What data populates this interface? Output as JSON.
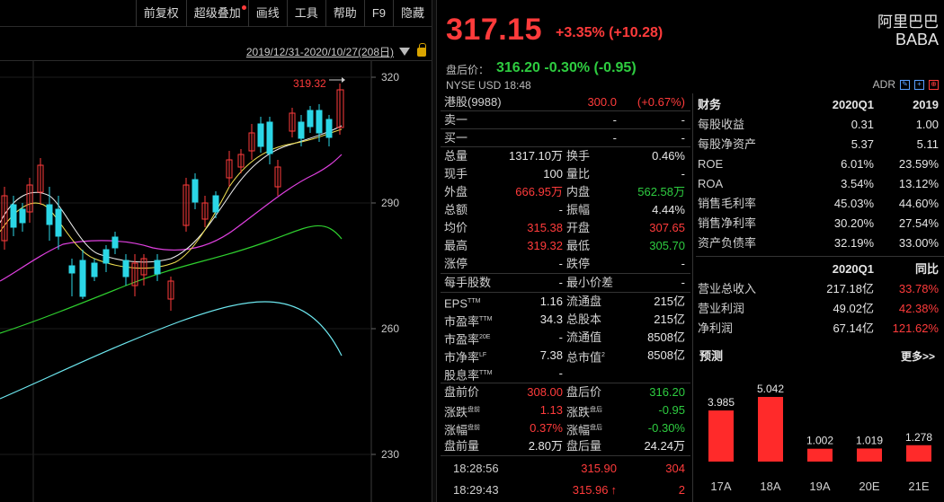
{
  "toolbar": {
    "items": [
      "前复权",
      "超级叠加",
      "画线",
      "工具",
      "帮助",
      "F9",
      "隐藏"
    ]
  },
  "chart": {
    "range": "2019/12/31-2020/10/27(208日)",
    "high_label": "319.32",
    "y_ticks": [
      "320",
      "290",
      "260",
      "230"
    ]
  },
  "header": {
    "price": "317.15",
    "change": "+3.35% (+10.28)",
    "name": "阿里巴巴",
    "code": "BABA",
    "after_hours_label": "盘后价：",
    "after_hours_value": "316.20 -0.30% (-0.95)",
    "exchange_line": "NYSE   USD   18:48",
    "adr_label": "ADR"
  },
  "hk": {
    "label": "港股(9988)",
    "price": "300.0",
    "change": "(+0.67%)"
  },
  "order_book": [
    {
      "label": "卖一",
      "price": "-",
      "vol": "-"
    },
    {
      "label": "买一",
      "price": "-",
      "vol": "-"
    }
  ],
  "stats": [
    {
      "l1": "总量",
      "v1": "1317.10万",
      "c1": "white",
      "l2": "换手",
      "v2": "0.46%",
      "c2": "white"
    },
    {
      "l1": "现手",
      "v1": "100",
      "c1": "white",
      "l2": "量比",
      "v2": "-",
      "c2": "white"
    },
    {
      "l1": "外盘",
      "v1": "666.95万",
      "c1": "red",
      "l2": "内盘",
      "v2": "562.58万",
      "c2": "green"
    },
    {
      "l1": "总额",
      "v1": "-",
      "c1": "white",
      "l2": "振幅",
      "v2": "4.44%",
      "c2": "white"
    },
    {
      "l1": "均价",
      "v1": "315.38",
      "c1": "red",
      "l2": "开盘",
      "v2": "307.65",
      "c2": "red"
    },
    {
      "l1": "最高",
      "v1": "319.32",
      "c1": "red",
      "l2": "最低",
      "v2": "305.70",
      "c2": "green"
    },
    {
      "l1": "涨停",
      "v1": "-",
      "c1": "white",
      "l2": "跌停",
      "v2": "-",
      "c2": "white"
    }
  ],
  "stats2": [
    {
      "l1": "每手股数",
      "v1": "-",
      "c1": "white",
      "l2": "最小价差",
      "v2": "-",
      "c2": "white"
    }
  ],
  "stats3": [
    {
      "l1": "EPS",
      "s1": "TTM",
      "v1": "1.16",
      "c1": "white",
      "l2": "流通盘",
      "s2": "",
      "v2": "215亿",
      "c2": "white"
    },
    {
      "l1": "市盈率",
      "s1": "TTM",
      "v1": "34.3",
      "c1": "white",
      "l2": "总股本",
      "s2": "",
      "v2": "215亿",
      "c2": "white"
    },
    {
      "l1": "市盈率",
      "s1": "20E",
      "v1": "-",
      "c1": "white",
      "l2": "流通值",
      "s2": "",
      "v2": "8508亿",
      "c2": "white"
    },
    {
      "l1": "市净率",
      "s1": "LF",
      "v1": "7.38",
      "c1": "white",
      "l2": "总市值",
      "s2": "2",
      "v2": "8508亿",
      "c2": "white"
    },
    {
      "l1": "股息率",
      "s1": "TTM",
      "v1": "-",
      "c1": "white",
      "l2": "",
      "s2": "",
      "v2": "",
      "c2": "white"
    }
  ],
  "stats4": [
    {
      "l1": "盘前价",
      "s1": "",
      "v1": "308.00",
      "c1": "red",
      "l2": "盘后价",
      "s2": "",
      "v2": "316.20",
      "c2": "green"
    },
    {
      "l1": "涨跌",
      "s1": "盘前",
      "v1": "1.13",
      "c1": "red",
      "l2": "涨跌",
      "s2": "盘后",
      "v2": "-0.95",
      "c2": "green"
    },
    {
      "l1": "涨幅",
      "s1": "盘前",
      "v1": "0.37%",
      "c1": "red",
      "l2": "涨幅",
      "s2": "盘后",
      "v2": "-0.30%",
      "c2": "green"
    },
    {
      "l1": "盘前量",
      "s1": "",
      "v1": "2.80万",
      "c1": "white",
      "l2": "盘后量",
      "s2": "",
      "v2": "24.24万",
      "c2": "white"
    }
  ],
  "trades": [
    {
      "time": "18:28:56",
      "price": "315.90",
      "vol": "304",
      "arrow": ""
    },
    {
      "time": "18:29:43",
      "price": "315.96",
      "vol": "2",
      "arrow": "↑"
    }
  ],
  "finance": {
    "title": "财务",
    "col1": "2020Q1",
    "col2": "2019",
    "rows": [
      {
        "label": "每股收益",
        "v1": "0.31",
        "v2": "1.00"
      },
      {
        "label": "每股净资产",
        "v1": "5.37",
        "v2": "5.11"
      },
      {
        "label": "ROE",
        "v1": "6.01%",
        "v2": "23.59%"
      },
      {
        "label": "ROA",
        "v1": "3.54%",
        "v2": "13.12%"
      },
      {
        "label": "销售毛利率",
        "v1": "45.03%",
        "v2": "44.60%"
      },
      {
        "label": "销售净利率",
        "v1": "30.20%",
        "v2": "27.54%"
      },
      {
        "label": "资产负债率",
        "v1": "32.19%",
        "v2": "33.00%"
      }
    ],
    "col1b": "2020Q1",
    "col2b": "同比",
    "rows2": [
      {
        "label": "营业总收入",
        "v1": "217.18亿",
        "v2": "33.78%"
      },
      {
        "label": "营业利润",
        "v1": "49.02亿",
        "v2": "42.38%"
      },
      {
        "label": "净利润",
        "v1": "67.14亿",
        "v2": "121.62%"
      }
    ]
  },
  "forecast": {
    "title": "预测",
    "more": "更多>>",
    "bar_color": "#ff2a2a"
  },
  "chart_data": {
    "type": "bar",
    "categories": [
      "17A",
      "18A",
      "19A",
      "20E",
      "21E"
    ],
    "values": [
      3.985,
      5.042,
      1.002,
      1.019,
      1.278
    ],
    "labels": [
      "3.985",
      "5.042",
      "1.002",
      "1.019",
      "1.278"
    ]
  }
}
